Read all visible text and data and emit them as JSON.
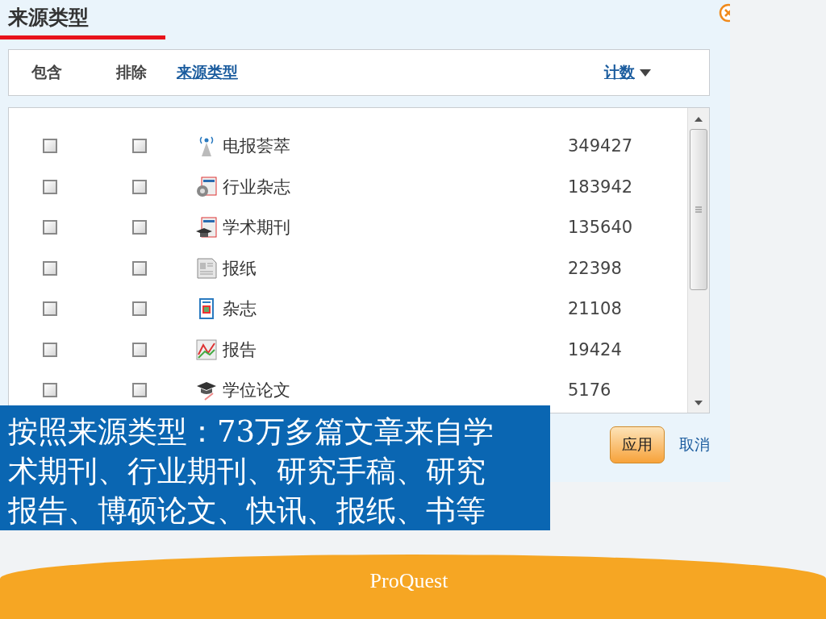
{
  "panel": {
    "title": "来源类型"
  },
  "columns": [
    {
      "label": "包含",
      "kind": "plain"
    },
    {
      "label": "排除",
      "kind": "plain"
    },
    {
      "label": "来源类型",
      "kind": "link"
    },
    {
      "label": "计数",
      "kind": "sort"
    }
  ],
  "rows": [
    {
      "kind": "wire",
      "name": "电报荟萃",
      "count": "349427",
      "include": false,
      "exclude": false
    },
    {
      "kind": "trade",
      "name": "行业杂志",
      "count": "183942",
      "include": false,
      "exclude": false
    },
    {
      "kind": "scholarly",
      "name": "学术期刊",
      "count": "135640",
      "include": false,
      "exclude": false
    },
    {
      "kind": "newspaper",
      "name": "报纸",
      "count": "22398",
      "include": false,
      "exclude": false
    },
    {
      "kind": "magazine",
      "name": "杂志",
      "count": "21108",
      "include": false,
      "exclude": false
    },
    {
      "kind": "report",
      "name": "报告",
      "count": "19424",
      "include": false,
      "exclude": false
    },
    {
      "kind": "dissertation",
      "name": "学位论文",
      "count": "5176",
      "include": false,
      "exclude": false
    }
  ],
  "buttons": [
    {
      "label": "应用",
      "kind": "primary"
    },
    {
      "label": "取消",
      "kind": "link"
    }
  ],
  "callout": {
    "text": "按照来源类型：73万多篇文章来自学术期刊、行业期刊、研究手稿、研究报告、博硕论文、快讯、报纸、书等"
  },
  "footer": {
    "logo": "ProQuest"
  }
}
